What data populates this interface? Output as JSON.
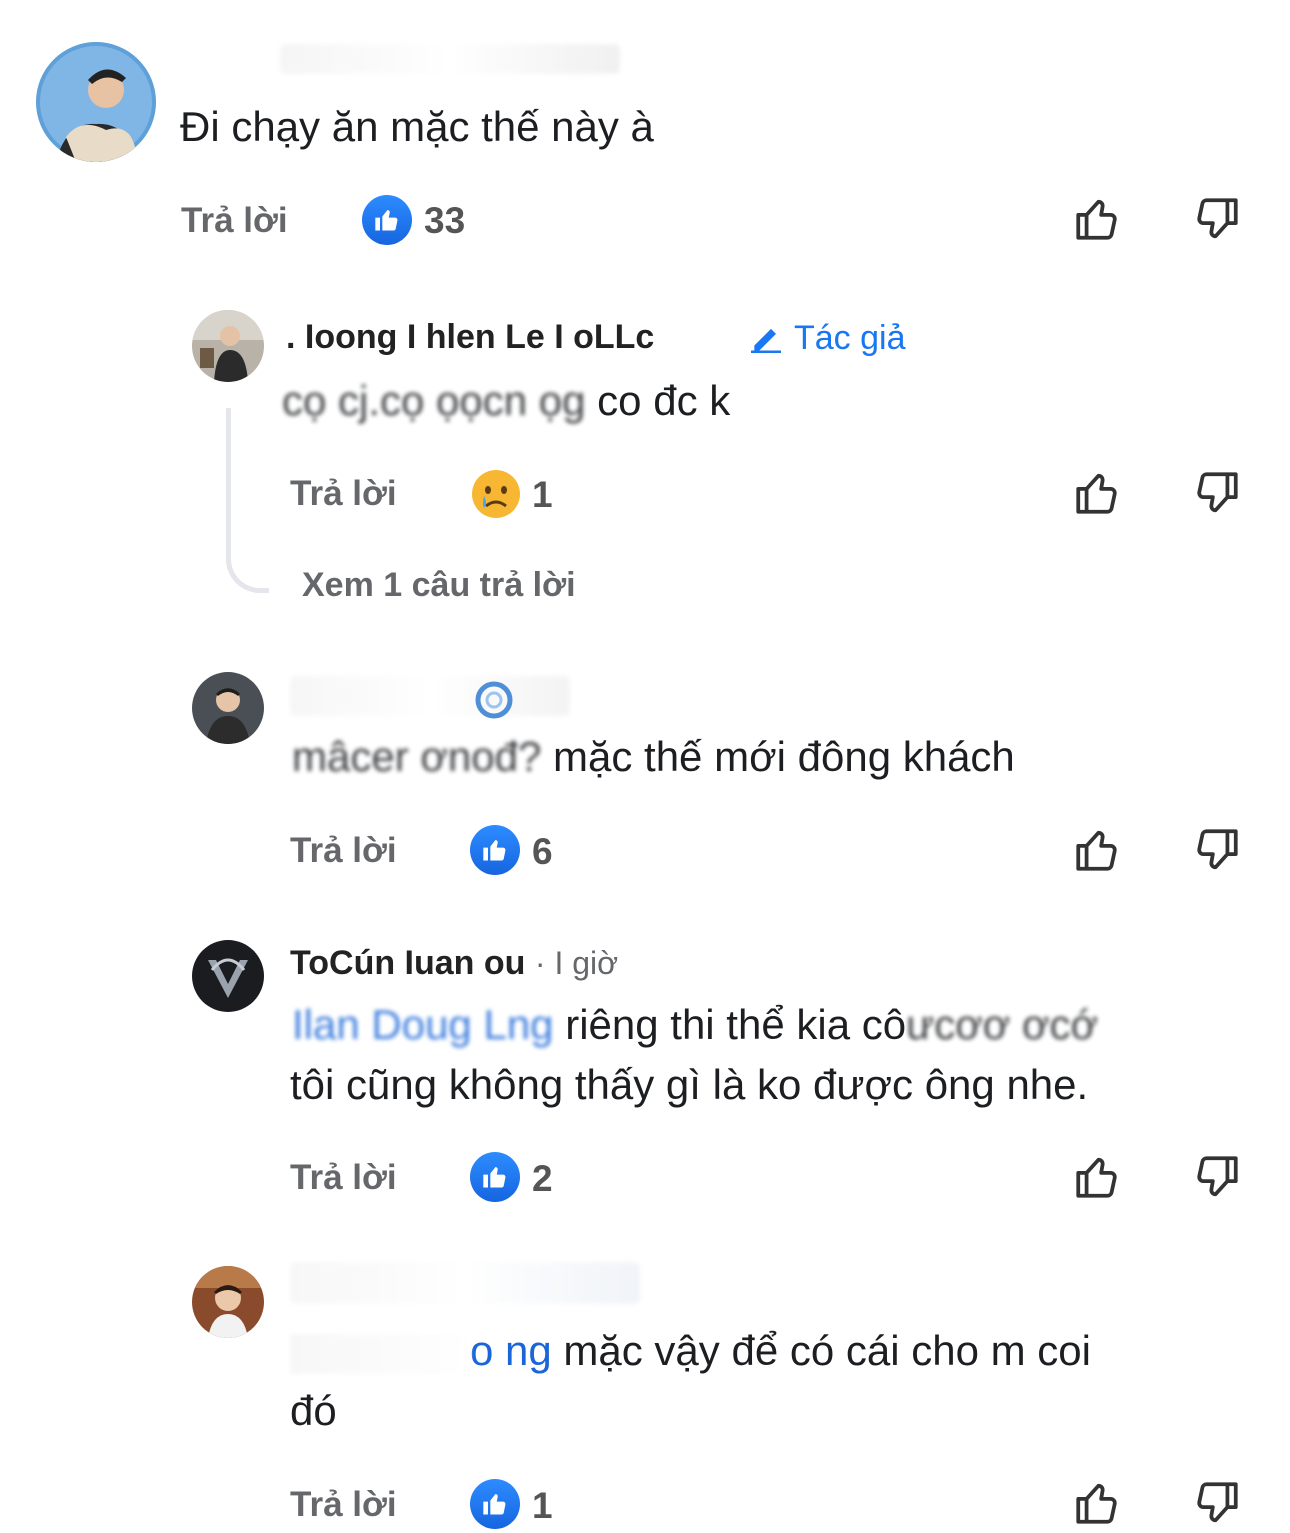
{
  "comments": [
    {
      "name": "",
      "text": "Đi chạy ăn mặc thế này à",
      "reply_label": "Trả lời",
      "reaction_count": "33"
    },
    {
      "name": ". Ioong I hlen Le I oLLc",
      "author_badge": "Tác giả",
      "text_blurred": "cọ cj.cọ ọọcn ọg",
      "text": " co đc k",
      "reply_label": "Trả lời",
      "reaction_count": "1",
      "view_replies": "Xem 1 câu trả lời"
    },
    {
      "name": "",
      "text_blurred": "mâcer     ơnođ?",
      "text": "mặc thế mới đông khách",
      "reply_label": "Trả lời",
      "reaction_count": "6"
    },
    {
      "name": "ToCún Iuan ou",
      "time": "· I giờ",
      "mention": "Ilan Doug Lng",
      "text_line1": " riêng thi thể kia cô",
      "text_line1_blur": "ưcơơ ơcớ",
      "text_line2": "tôi cũng không thấy gì là ko được ông nhe.",
      "reply_label": "Trả lời",
      "reaction_count": "2"
    },
    {
      "name": "",
      "mention": "o ng",
      "text_line1": " mặc vậy để có cái cho m coi",
      "text_line2": "đó",
      "reply_label": "Trả lời",
      "reaction_count": "1"
    }
  ],
  "icons": {
    "like_reaction": "thumbs-up-icon",
    "sad_reaction": "crying-face-icon",
    "upvote": "thumb-up-outline-icon",
    "downvote": "thumb-down-outline-icon",
    "author_badge": "pencil-icon"
  },
  "colors": {
    "like_blue": "#1877f2",
    "meta_gray": "#65676b",
    "mention_blue": "#1a66d8"
  }
}
